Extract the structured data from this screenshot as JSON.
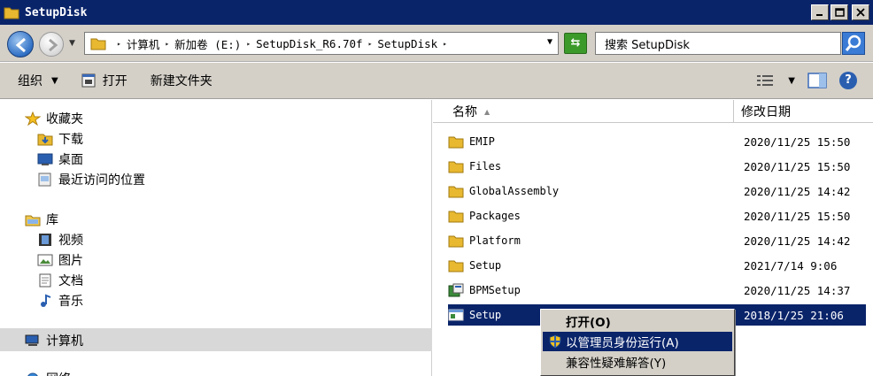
{
  "window": {
    "title": "SetupDisk"
  },
  "address": {
    "breadcrumbs": [
      "计算机",
      "新加卷 (E:)",
      "SetupDisk_R6.70f",
      "SetupDisk"
    ]
  },
  "search": {
    "placeholder": "搜索 SetupDisk"
  },
  "toolbar": {
    "organize": "组织",
    "open": "打开",
    "new_folder": "新建文件夹"
  },
  "nav": {
    "favorites": {
      "label": "收藏夹",
      "items": [
        "下载",
        "桌面",
        "最近访问的位置"
      ]
    },
    "libraries": {
      "label": "库",
      "items": [
        "视频",
        "图片",
        "文档",
        "音乐"
      ]
    },
    "computer": "计算机",
    "network_partial": "网络"
  },
  "columns": {
    "name": "名称",
    "date": "修改日期"
  },
  "files": [
    {
      "name": "EMIP",
      "date": "2020/11/25 15:50",
      "icon": "folder-icon"
    },
    {
      "name": "Files",
      "date": "2020/11/25 15:50",
      "icon": "folder-icon"
    },
    {
      "name": "GlobalAssembly",
      "date": "2020/11/25 14:42",
      "icon": "folder-icon"
    },
    {
      "name": "Packages",
      "date": "2020/11/25 15:50",
      "icon": "folder-icon"
    },
    {
      "name": "Platform",
      "date": "2020/11/25 14:42",
      "icon": "folder-icon"
    },
    {
      "name": "Setup",
      "date": "2021/7/14 9:06",
      "icon": "folder-icon"
    },
    {
      "name": "BPMSetup",
      "date": "2020/11/25 14:37",
      "icon": "installer-icon"
    },
    {
      "name": "Setup",
      "date": "2018/1/25 21:06",
      "icon": "application-icon",
      "selected": true
    }
  ],
  "context_menu": {
    "items": [
      "打开(O)",
      "以管理员身份运行(A)",
      "兼容性疑难解答(Y)"
    ],
    "highlighted_index": 1
  },
  "colors": {
    "titlebar": "#0a246a",
    "selection": "#0a246a",
    "chrome": "#d4d0c8",
    "folder": "#e8b830"
  }
}
